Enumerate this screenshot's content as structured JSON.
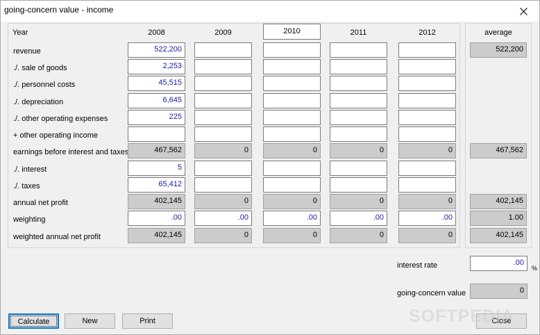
{
  "window": {
    "title": "going-concern value - income"
  },
  "table": {
    "year_header": "Year",
    "years": [
      "2008",
      "2009",
      "2010",
      "2011",
      "2012"
    ],
    "average_header": "average",
    "rows": [
      {
        "label": "revenue",
        "values": [
          "522,200",
          "",
          "",
          "",
          ""
        ],
        "editable": true,
        "average": "522,200"
      },
      {
        "label": "./. sale of goods",
        "values": [
          "2,253",
          "",
          "",
          "",
          ""
        ],
        "editable": true,
        "average": null
      },
      {
        "label": "./. personnel costs",
        "values": [
          "45,515",
          "",
          "",
          "",
          ""
        ],
        "editable": true,
        "average": null
      },
      {
        "label": "./. depreciation",
        "values": [
          "6,645",
          "",
          "",
          "",
          ""
        ],
        "editable": true,
        "average": null
      },
      {
        "label": "./. other operating expenses",
        "values": [
          "225",
          "",
          "",
          "",
          ""
        ],
        "editable": true,
        "average": null
      },
      {
        "label": "+ other operating income",
        "values": [
          "",
          "",
          "",
          "",
          ""
        ],
        "editable": true,
        "average": null
      },
      {
        "label": "earnings before interest and taxes",
        "values": [
          "467,562",
          "0",
          "0",
          "0",
          "0"
        ],
        "editable": false,
        "average": "467,562"
      },
      {
        "label": "./. interest",
        "values": [
          "5",
          "",
          "",
          "",
          ""
        ],
        "editable": true,
        "average": null
      },
      {
        "label": "./. taxes",
        "values": [
          "65,412",
          "",
          "",
          "",
          ""
        ],
        "editable": true,
        "average": null
      },
      {
        "label": "annual net profit",
        "values": [
          "402,145",
          "0",
          "0",
          "0",
          "0"
        ],
        "editable": false,
        "average": "402,145"
      },
      {
        "label": "weighting",
        "values": [
          ".00",
          ".00",
          ".00",
          ".00",
          ".00"
        ],
        "editable": true,
        "average": "1.00"
      },
      {
        "label": "weighted annual net profit",
        "values": [
          "402,145",
          "0",
          "0",
          "0",
          "0"
        ],
        "editable": false,
        "average": "402,145"
      }
    ]
  },
  "interest_rate": {
    "label": "interest rate",
    "value": ".00",
    "unit": "%"
  },
  "going_concern": {
    "label": "going-concern value",
    "value": "0"
  },
  "buttons": {
    "calculate": "Calculate",
    "new": "New",
    "print": "Print",
    "close": "Close"
  },
  "watermark": "SOFTPEDIA"
}
